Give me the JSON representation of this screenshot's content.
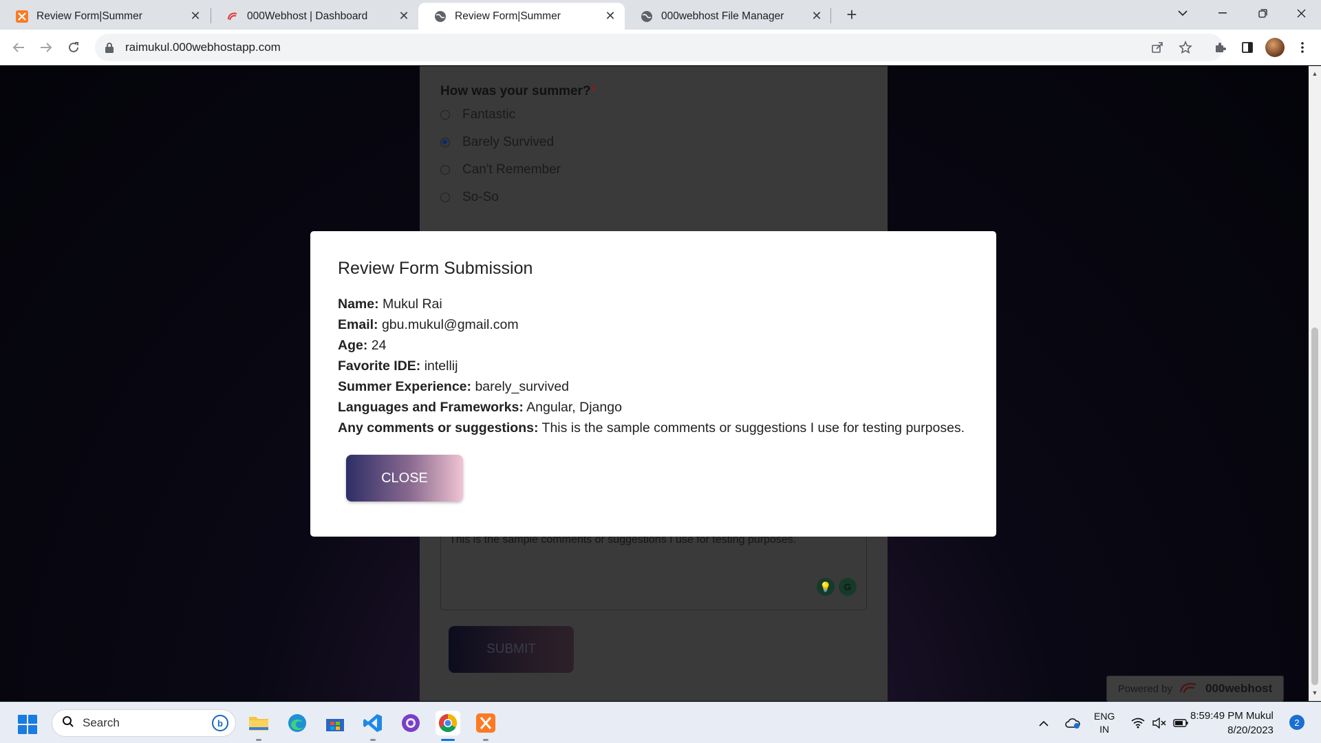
{
  "browser": {
    "tabs": [
      {
        "title": "Review Form|Summer",
        "active": false,
        "favicon": "xampp-icon"
      },
      {
        "title": "000Webhost | Dashboard",
        "active": false,
        "favicon": "000webhost-icon"
      },
      {
        "title": "Review Form|Summer",
        "active": true,
        "favicon": "globe-icon"
      },
      {
        "title": "000webhost File Manager",
        "active": false,
        "favicon": "globe-icon"
      }
    ],
    "url": "raimukul.000webhostapp.com"
  },
  "form": {
    "question": "How was your summer?",
    "required_mark": "*",
    "options": [
      {
        "label": "Fantastic",
        "selected": false
      },
      {
        "label": "Barely Survived",
        "selected": true
      },
      {
        "label": "Can't Remember",
        "selected": false
      },
      {
        "label": "So-So",
        "selected": false
      }
    ],
    "comments_value": "This is the sample comments or suggestions I use for testing purposes.",
    "submit_label": "SUBMIT"
  },
  "modal": {
    "title": "Review Form Submission",
    "fields": [
      {
        "label": "Name:",
        "value": "Mukul Rai"
      },
      {
        "label": "Email:",
        "value": "gbu.mukul@gmail.com"
      },
      {
        "label": "Age:",
        "value": "24"
      },
      {
        "label": "Favorite IDE:",
        "value": "intellij"
      },
      {
        "label": "Summer Experience:",
        "value": "barely_survived"
      },
      {
        "label": "Languages and Frameworks:",
        "value": "Angular, Django"
      },
      {
        "label": "Any comments or suggestions:",
        "value": "This is the sample comments or suggestions I use for testing purposes."
      }
    ],
    "close_label": "CLOSE"
  },
  "badge": {
    "powered_by": "Powered by",
    "brand": "000webhost"
  },
  "taskbar": {
    "search_placeholder": "Search",
    "lang_top": "ENG",
    "lang_bottom": "IN",
    "time": "8:59:49 PM Mukul",
    "date": "8/20/2023",
    "notifications": "2"
  },
  "colors": {
    "accent": "#1a73e8",
    "modal_button_start": "#2e2e66",
    "modal_button_end": "#f0c4d2"
  }
}
